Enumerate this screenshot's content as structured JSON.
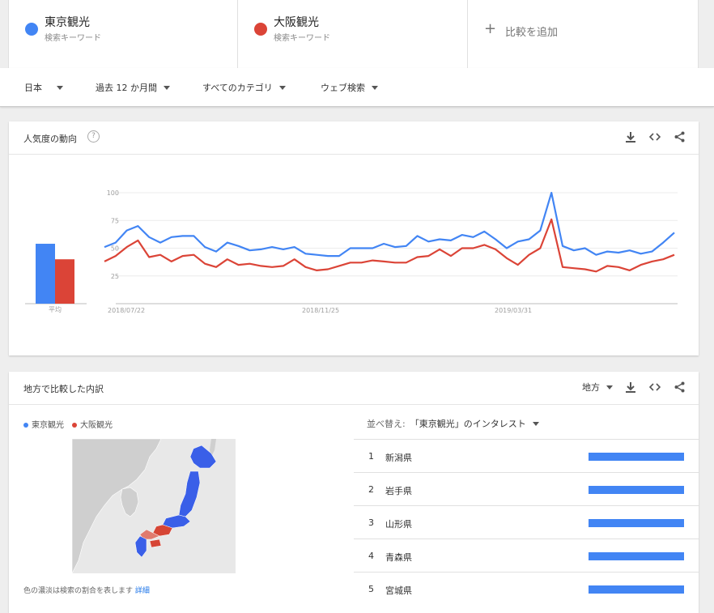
{
  "terms": [
    {
      "name": "東京観光",
      "sub": "検索キーワード",
      "color": "#4285f4"
    },
    {
      "name": "大阪観光",
      "sub": "検索キーワード",
      "color": "#db4437"
    }
  ],
  "add_compare": {
    "label": "比較を追加"
  },
  "filters": {
    "region": "日本",
    "period": "過去 12 か月間",
    "category": "すべてのカテゴリ",
    "search_type": "ウェブ検索"
  },
  "trend_card": {
    "title": "人気度の動向",
    "help": "?",
    "avg_label": "平均"
  },
  "chart_data": {
    "type": "line",
    "x_labels": [
      "2018/07/22",
      "2018/11/25",
      "2019/03/31"
    ],
    "y_ticks": [
      25,
      50,
      75,
      100
    ],
    "ylim": [
      0,
      100
    ],
    "series": [
      {
        "name": "東京観光",
        "color": "#4285f4",
        "average": 54,
        "values": [
          51,
          55,
          66,
          70,
          60,
          55,
          60,
          61,
          61,
          51,
          47,
          55,
          52,
          48,
          49,
          51,
          49,
          51,
          45,
          44,
          43,
          43,
          50,
          50,
          50,
          54,
          51,
          52,
          61,
          56,
          58,
          57,
          62,
          60,
          65,
          58,
          50,
          56,
          58,
          66,
          100,
          52,
          48,
          50,
          44,
          47,
          46,
          48,
          45,
          47,
          55,
          64
        ]
      },
      {
        "name": "大阪観光",
        "color": "#db4437",
        "average": 40,
        "values": [
          38,
          43,
          51,
          57,
          42,
          44,
          38,
          43,
          44,
          36,
          33,
          40,
          35,
          36,
          34,
          33,
          34,
          40,
          33,
          30,
          31,
          34,
          37,
          37,
          39,
          38,
          37,
          37,
          42,
          43,
          49,
          43,
          50,
          50,
          53,
          49,
          41,
          35,
          44,
          50,
          76,
          33,
          32,
          31,
          29,
          34,
          33,
          30,
          35,
          38,
          40,
          44
        ]
      }
    ]
  },
  "region_card": {
    "title": "地方で比較した内訳",
    "resolution": "地方",
    "legend": [
      {
        "name": "東京観光",
        "color": "#4285f4"
      },
      {
        "name": "大阪観光",
        "color": "#db4437"
      }
    ],
    "footnote": "色の濃淡は検索の割合を表します",
    "footnote_link": "詳細",
    "sort_prefix": "並べ替え:",
    "sort_value": "「東京観光」のインタレスト",
    "rows": [
      {
        "rank": "1",
        "name": "新潟県",
        "value": 100
      },
      {
        "rank": "2",
        "name": "岩手県",
        "value": 100
      },
      {
        "rank": "3",
        "name": "山形県",
        "value": 100
      },
      {
        "rank": "4",
        "name": "青森県",
        "value": 100
      },
      {
        "rank": "5",
        "name": "宮城県",
        "value": 100
      }
    ]
  }
}
